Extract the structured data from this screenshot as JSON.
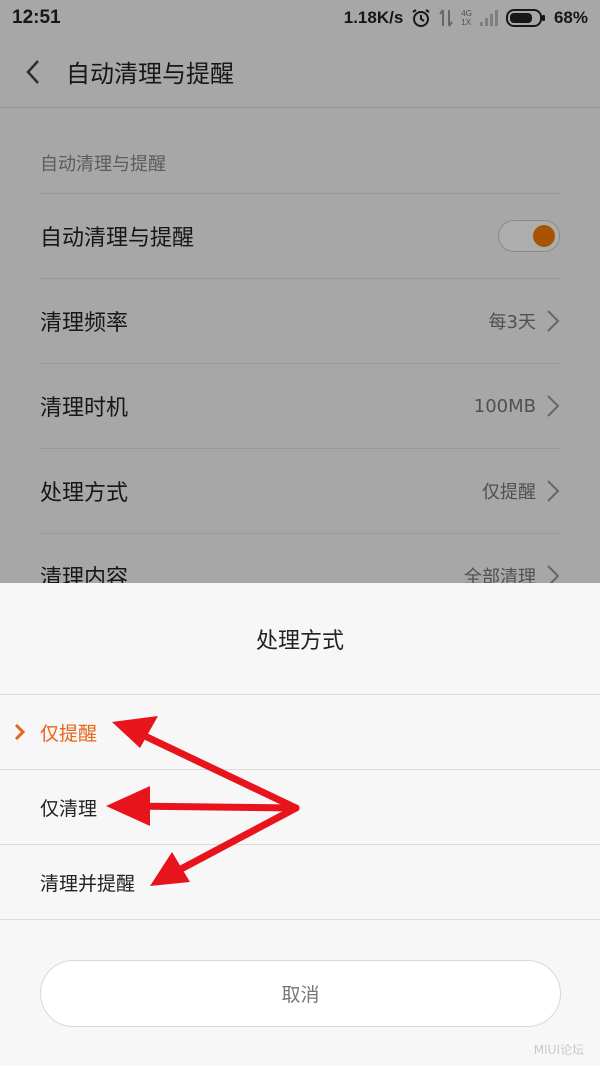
{
  "statusbar": {
    "time": "12:51",
    "net_speed": "1.18K/s",
    "net_type_top": "4G",
    "net_type_bottom": "1X",
    "battery": "68%",
    "icons": [
      "alarm-icon",
      "data-arrows-icon",
      "signal-icon",
      "battery-icon"
    ]
  },
  "header": {
    "title": "自动清理与提醒",
    "back_icon": "chevron-left-icon"
  },
  "settings": {
    "section_title": "自动清理与提醒",
    "rows": [
      {
        "label": "自动清理与提醒",
        "type": "toggle",
        "on": true
      },
      {
        "label": "清理频率",
        "value": "每3天"
      },
      {
        "label": "清理时机",
        "value": "100MB"
      },
      {
        "label": "处理方式",
        "value": "仅提醒"
      },
      {
        "label": "清理内容",
        "value": "全部清理"
      }
    ]
  },
  "sheet": {
    "title": "处理方式",
    "options": [
      {
        "label": "仅提醒",
        "selected": true
      },
      {
        "label": "仅清理",
        "selected": false
      },
      {
        "label": "清理并提醒",
        "selected": false
      }
    ],
    "cancel_label": "取消"
  },
  "watermark": "MIUI论坛",
  "colors": {
    "accent": "#e8641a",
    "toggle_on": "#f57c00",
    "annotation_arrow": "#e8141b",
    "background": "#f7f7f7"
  }
}
